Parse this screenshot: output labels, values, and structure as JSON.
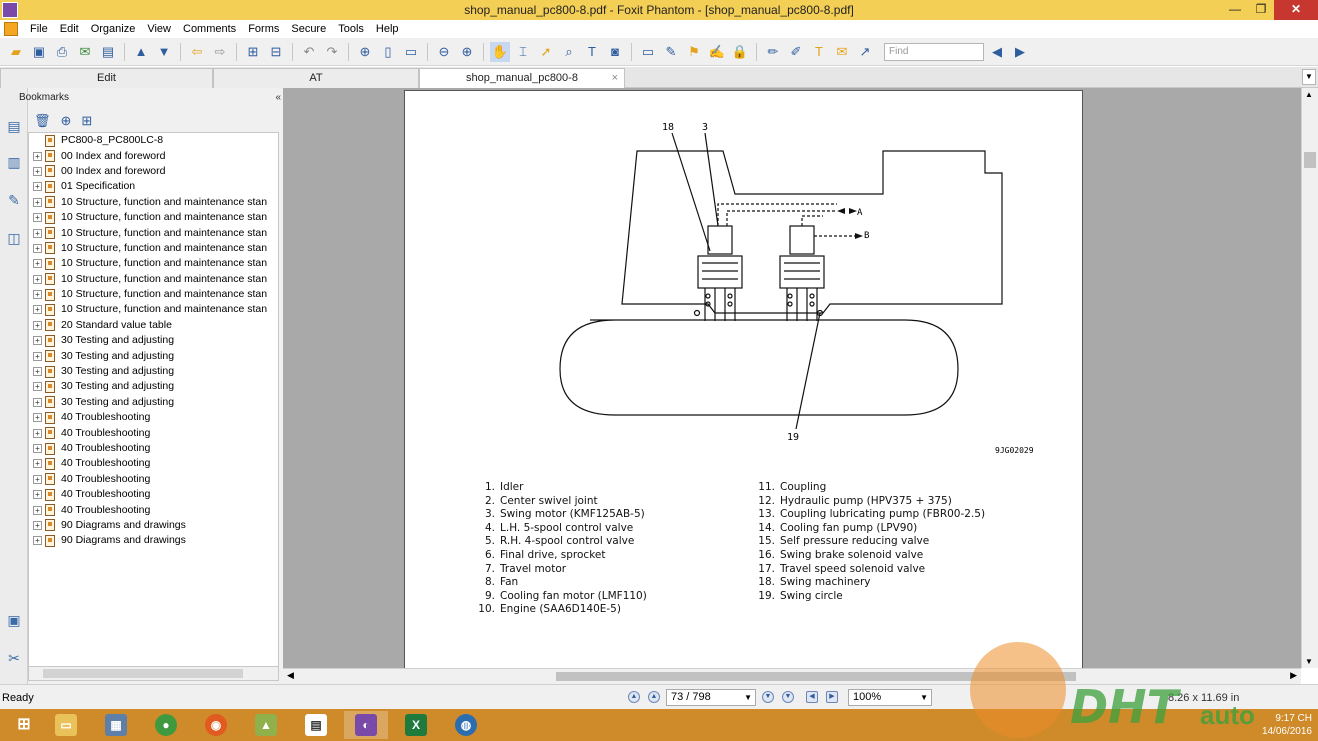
{
  "window": {
    "title": "shop_manual_pc800-8.pdf - Foxit Phantom - [shop_manual_pc800-8.pdf]"
  },
  "menu": [
    "File",
    "Edit",
    "Organize",
    "View",
    "Comments",
    "Forms",
    "Secure",
    "Tools",
    "Help"
  ],
  "toolbar": {
    "find_placeholder": "Find"
  },
  "tabs": [
    {
      "label": "Edit"
    },
    {
      "label": "AT"
    },
    {
      "label": "shop_manual_pc800-8",
      "close": "×"
    }
  ],
  "bookmarks": {
    "header": "Bookmarks",
    "collapse_icon": "«",
    "root": "PC800-8_PC800LC-8",
    "items": [
      "00 Index and foreword",
      "00 Index and foreword",
      "01 Specification",
      "10 Structure, function and maintenance stan",
      "10 Structure, function and maintenance stan",
      "10 Structure, function and maintenance stan",
      "10 Structure, function and maintenance stan",
      "10 Structure, function and maintenance stan",
      "10 Structure, function and maintenance stan",
      "10 Structure, function and maintenance stan",
      "10 Structure, function and maintenance stan",
      "20 Standard value table",
      "30 Testing and adjusting",
      "30 Testing and adjusting",
      "30 Testing and adjusting",
      "30 Testing and adjusting",
      "30 Testing and adjusting",
      "40 Troubleshooting",
      "40 Troubleshooting",
      "40 Troubleshooting",
      "40 Troubleshooting",
      "40 Troubleshooting",
      "40 Troubleshooting",
      "40 Troubleshooting",
      "90 Diagrams and drawings",
      "90 Diagrams and drawings"
    ]
  },
  "diagram": {
    "callout_18": "18",
    "callout_3": "3",
    "callout_19": "19",
    "label_a": "A",
    "label_b": "B",
    "figure_id": "9JG02029"
  },
  "legend_left": [
    {
      "n": "1.",
      "t": "Idler"
    },
    {
      "n": "2.",
      "t": "Center swivel joint"
    },
    {
      "n": "3.",
      "t": "Swing motor (KMF125AB-5)"
    },
    {
      "n": "4.",
      "t": "L.H. 5-spool control valve"
    },
    {
      "n": "5.",
      "t": "R.H. 4-spool control valve"
    },
    {
      "n": "6.",
      "t": "Final drive, sprocket"
    },
    {
      "n": "7.",
      "t": "Travel motor"
    },
    {
      "n": "8.",
      "t": "Fan"
    },
    {
      "n": "9.",
      "t": "Cooling fan motor (LMF110)"
    },
    {
      "n": "10.",
      "t": "Engine (SAA6D140E-5)"
    }
  ],
  "legend_right": [
    {
      "n": "11.",
      "t": "Coupling"
    },
    {
      "n": "12.",
      "t": "Hydraulic pump (HPV375 + 375)"
    },
    {
      "n": "13.",
      "t": "Coupling lubricating pump (FBR00-2.5)"
    },
    {
      "n": "14.",
      "t": "Cooling fan pump (LPV90)"
    },
    {
      "n": "15.",
      "t": "Self pressure reducing valve"
    },
    {
      "n": "16.",
      "t": "Swing brake solenoid valve"
    },
    {
      "n": "17.",
      "t": "Travel speed solenoid valve"
    },
    {
      "n": "18.",
      "t": "Swing machinery"
    },
    {
      "n": "19.",
      "t": "Swing circle"
    }
  ],
  "status": {
    "ready": "Ready",
    "page": "73 / 798",
    "zoom": "100%",
    "size": "8.26 x 11.69 in"
  },
  "taskbar": {
    "time": "9:17 CH",
    "date": "14/06/2016"
  },
  "watermark": {
    "text": "DHT",
    "sub": "auto"
  }
}
